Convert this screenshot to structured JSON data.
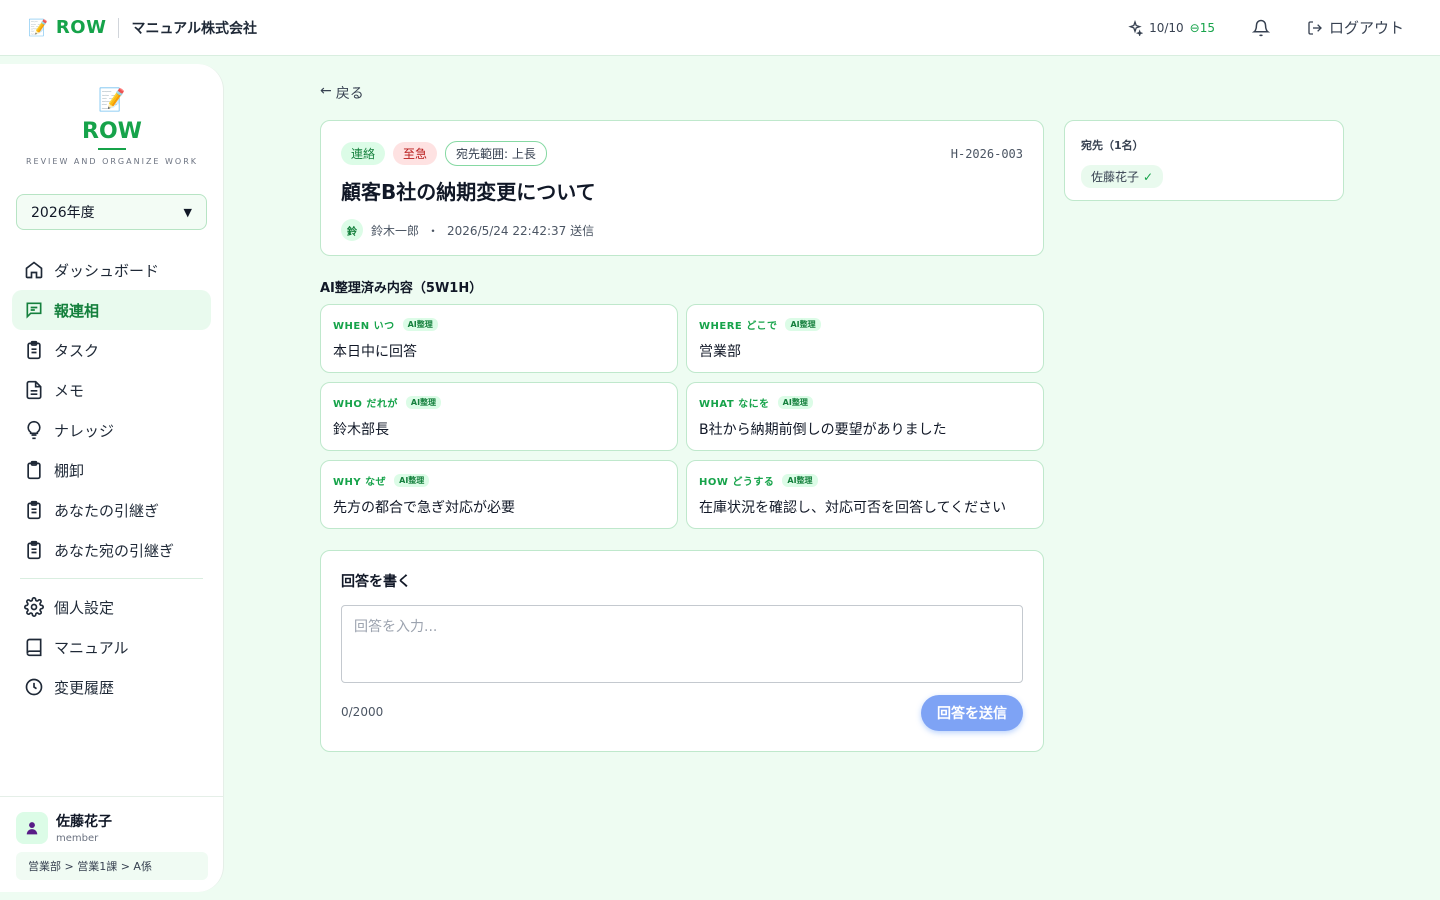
{
  "header": {
    "brand": "ROW",
    "company": "マニュアル株式会社",
    "credits": "10/10",
    "credits_plus": "⊖15",
    "logout_label": "ログアウト"
  },
  "sidebar": {
    "logo_name": "ROW",
    "tagline": "REVIEW AND ORGANIZE WORK",
    "year": "2026年度",
    "items": [
      {
        "label": "ダッシュボード"
      },
      {
        "label": "報連相"
      },
      {
        "label": "タスク"
      },
      {
        "label": "メモ"
      },
      {
        "label": "ナレッジ"
      },
      {
        "label": "棚卸"
      },
      {
        "label": "あなたの引継ぎ"
      },
      {
        "label": "あなた宛の引継ぎ"
      },
      {
        "label": "個人設定"
      },
      {
        "label": "マニュアル"
      },
      {
        "label": "変更履歴"
      }
    ],
    "user": {
      "name": "佐藤花子",
      "role": "member",
      "dept": "営業部 > 営業1課 > A係"
    }
  },
  "main": {
    "back_label": "戻る",
    "message": {
      "badge_type": "連絡",
      "badge_urgency": "至急",
      "badge_scope": "宛先範囲: 上長",
      "id": "H-2026-003",
      "title": "顧客B社の納期変更について",
      "sender_initial": "鈴",
      "sender": "鈴木一郎",
      "dot": "・",
      "sent_at": "2026/5/24 22:42:37 送信"
    },
    "recipients": {
      "title": "宛先（1名）",
      "items": [
        {
          "name": "佐藤花子",
          "check": "✓"
        }
      ]
    },
    "ai_heading": "AI整理済み内容（5W1H）",
    "ai_tag": "AI整理",
    "w5h1": [
      {
        "label": "WHEN いつ",
        "value": "本日中に回答"
      },
      {
        "label": "WHERE どこで",
        "value": "営業部"
      },
      {
        "label": "WHO だれが",
        "value": "鈴木部長"
      },
      {
        "label": "WHAT なにを",
        "value": "B社から納期前倒しの要望がありました"
      },
      {
        "label": "WHY なぜ",
        "value": "先方の都合で急ぎ対応が必要"
      },
      {
        "label": "HOW どうする",
        "value": "在庫状況を確認し、対応可否を回答してください"
      }
    ],
    "reply": {
      "title": "回答を書く",
      "placeholder": "回答を入力...",
      "count": "0/2000",
      "submit_label": "回答を送信"
    }
  },
  "colors": {
    "accent": "#16a34a",
    "background": "#eefcf2",
    "urgent": "#b91c1c",
    "submit": "#7ea3f5"
  }
}
